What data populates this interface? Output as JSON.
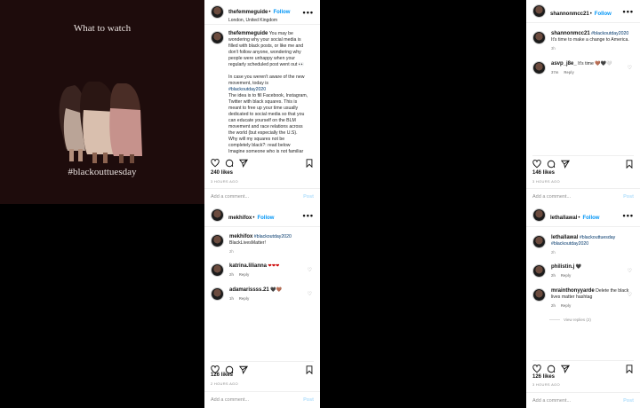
{
  "image_post": {
    "heading": "What to watch",
    "hashtag": "#blackouttuesday"
  },
  "post1": {
    "username": "thefemmeguide",
    "follow": "Follow",
    "location": "London, United Kingdom",
    "caption_user": "thefemmeguide",
    "caption_lines": [
      "You may be",
      "wondering why your social media is",
      "filled with black posts, or like me and",
      "don't follow anyone, wondering why",
      "people were unhappy when your",
      "regularly scheduled post went out 👀",
      "",
      "In case you weren't aware of the new",
      "movement, today is",
      "#blackoutday2020",
      "The idea is to fill Facebook, Instagram,",
      "Twitter with black squares. This is",
      "meant to free up your time usually",
      "dedicated to social media so that you",
      "can educate yourself on the BLM",
      "movement and race relations across",
      "the world (but especially the U.S).",
      "Why will my squares not be",
      "completely black?: read below",
      "Imagine someone who is not familiar"
    ],
    "likes": "240 likes",
    "time": "3 HOURS AGO",
    "add_comment": "Add a comment...",
    "post_btn": "Post"
  },
  "post2": {
    "username": "mekhifox",
    "follow": "Follow",
    "caption_user": "mekhifox",
    "caption_tag": "#blackoutday2020",
    "caption_text": "BlackLivesMatter!",
    "caption_time": "2h",
    "comments": [
      {
        "user": "katrina.lilianna",
        "text": "❤❤❤",
        "time": "2h",
        "reply": "Reply"
      },
      {
        "user": "adamarissss.21",
        "text": "🖤🤎",
        "time": "1h",
        "reply": "Reply"
      }
    ],
    "likes": "126 likes",
    "time": "2 HOURS AGO",
    "add_comment": "Add a comment...",
    "post_btn": "Post"
  },
  "post3": {
    "username": "shannonmcc21",
    "follow": "Follow",
    "caption_user": "shannonmcc21",
    "caption_tag": "#blackoutday2020",
    "caption_text": "It's time to make a change to America.",
    "caption_time": "3h",
    "comments": [
      {
        "user": "asvp_j8e_",
        "text": "It's time 🤎🖤🤍",
        "time": "37m",
        "reply": "Reply"
      }
    ],
    "likes": "146 likes",
    "time": "3 HOURS AGO",
    "add_comment": "Add a comment...",
    "post_btn": "Post"
  },
  "post4": {
    "username": "lethallawal",
    "follow": "Follow",
    "caption_user": "lethallawal",
    "caption_tag": "#blackouttuesday #blackoutday2020",
    "caption_time": "2h",
    "comments": [
      {
        "user": "philistin.j",
        "text": "🖤",
        "time": "2h",
        "reply": "Reply"
      },
      {
        "user": "mrainthonyyarde",
        "text": "Delete the black lives matter hashtag",
        "time": "2h",
        "reply": "Reply"
      }
    ],
    "view_replies": "View replies (2)",
    "likes": "126 likes",
    "time": "3 HOURS AGO",
    "add_comment": "Add a comment...",
    "post_btn": "Post"
  },
  "colors": {
    "follow": "#0095f6",
    "image_bg": "#1e0c0c",
    "tag": "#00376b"
  }
}
